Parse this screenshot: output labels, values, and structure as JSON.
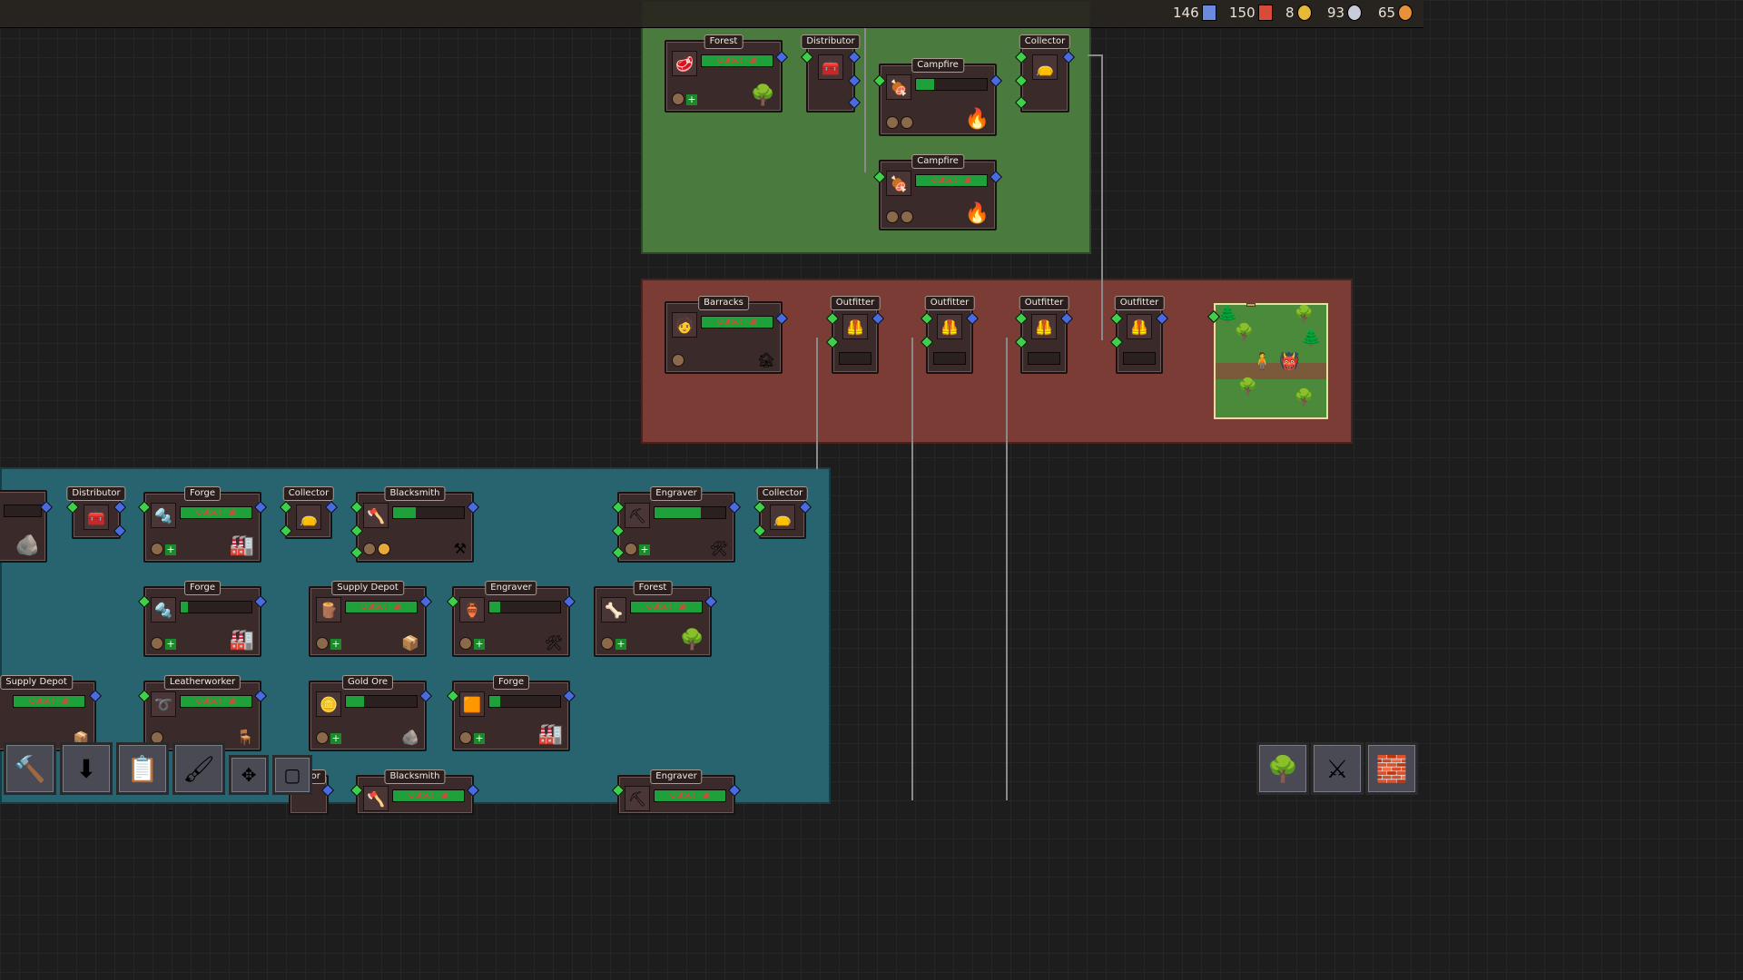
{
  "resources": [
    {
      "value": "146",
      "icon": "medal-icon",
      "color": "#6a8ae0"
    },
    {
      "value": "150",
      "icon": "guild-shield-icon",
      "color": "#d84a3a"
    },
    {
      "value": "8",
      "icon": "gold-coin-icon",
      "color": "#e8b83a"
    },
    {
      "value": "93",
      "icon": "silver-coin-icon",
      "color": "#c8ccd8"
    },
    {
      "value": "65",
      "icon": "copper-coin-icon",
      "color": "#e8903a"
    }
  ],
  "status": {
    "output_full": "Output Full"
  },
  "nodes": {
    "forest_top": "Forest",
    "distributor_top": "Distributor",
    "campfire_1": "Campfire",
    "campfire_2": "Campfire",
    "collector_top": "Collector",
    "barracks": "Barracks",
    "outfitter_1": "Outfitter",
    "outfitter_2": "Outfitter",
    "outfitter_3": "Outfitter",
    "outfitter_4": "Outfitter",
    "distributor_bl": "Distributor",
    "forge_1": "Forge",
    "collector_bl": "Collector",
    "blacksmith_1": "Blacksmith",
    "engraver_1": "Engraver",
    "collector_br": "Collector",
    "forge_2": "Forge",
    "supply_depot_1": "Supply Depot",
    "engraver_2": "Engraver",
    "forest_bl": "Forest",
    "supply_depot_2": "Supply Depot",
    "leatherworker": "Leatherworker",
    "gold_ore": "Gold Ore",
    "forge_3": "Forge",
    "collector_partial": "ector",
    "blacksmith_2": "Blacksmith",
    "engraver_3": "Engraver"
  },
  "progress": {
    "campfire_1": 0.25,
    "blacksmith_1": 0.32,
    "engraver_1": 0.65,
    "forge_2": 0.1,
    "engraver_2": 0.15,
    "gold_ore": 0.25,
    "forge_3": 0.15
  },
  "toolbar": [
    {
      "icon": "hammer-build-icon"
    },
    {
      "icon": "download-arrow-icon"
    },
    {
      "icon": "blueprint-board-icon"
    },
    {
      "icon": "paint-brush-icon"
    },
    {
      "icon": "move-arrows-icon"
    },
    {
      "icon": "window-frame-icon"
    }
  ],
  "right_toolbar": [
    {
      "icon": "tree-icon"
    },
    {
      "icon": "crossed-swords-icon"
    },
    {
      "icon": "brick-wall-icon"
    }
  ],
  "colors": {
    "green_region": "#4a7a3e",
    "red_region": "#7a3c34",
    "teal_region": "#286470",
    "progress_fill": "#1ea13a"
  }
}
